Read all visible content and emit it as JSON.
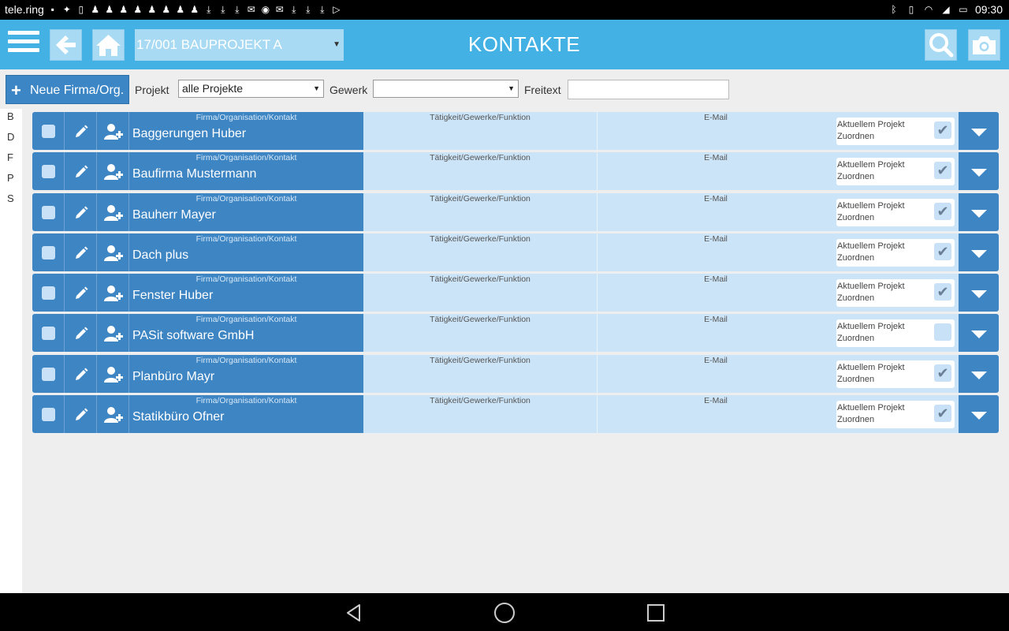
{
  "statusbar": {
    "app": "tele.ring",
    "time": "09:30"
  },
  "header": {
    "project": "17/001 BAUPROJEKT A",
    "title": "KONTAKTE"
  },
  "filters": {
    "new_label": "Neue Firma/Org.",
    "project_label": "Projekt",
    "project_value": "alle Projekte",
    "gewerk_label": "Gewerk",
    "gewerk_value": "",
    "freitext_label": "Freitext",
    "freitext_value": ""
  },
  "alphabet": [
    "B",
    "D",
    "F",
    "P",
    "S"
  ],
  "labels": {
    "name": "Firma/Organisation/Kontakt",
    "taetigkeit": "Tätigkeit/Gewerke/Funktion",
    "email": "E-Mail",
    "assign": "Aktuellem Projekt Zuordnen"
  },
  "contacts": [
    {
      "name": "Baggerungen Huber",
      "taetigkeit": "",
      "email": "",
      "assigned": true
    },
    {
      "name": "Baufirma Mustermann",
      "taetigkeit": "",
      "email": "",
      "assigned": true
    },
    {
      "name": "Bauherr Mayer",
      "taetigkeit": "",
      "email": "",
      "assigned": true
    },
    {
      "name": "Dach plus",
      "taetigkeit": "",
      "email": "",
      "assigned": true
    },
    {
      "name": "Fenster Huber",
      "taetigkeit": "",
      "email": "",
      "assigned": true
    },
    {
      "name": "PASit software GmbH",
      "taetigkeit": "",
      "email": "",
      "assigned": false
    },
    {
      "name": "Planbüro Mayr",
      "taetigkeit": "",
      "email": "",
      "assigned": true
    },
    {
      "name": "Statikbüro Ofner",
      "taetigkeit": "",
      "email": "",
      "assigned": true
    }
  ],
  "colors": {
    "header": "#44b1e5",
    "row_dark": "#3e85c4",
    "row_light": "#cce4f7"
  }
}
